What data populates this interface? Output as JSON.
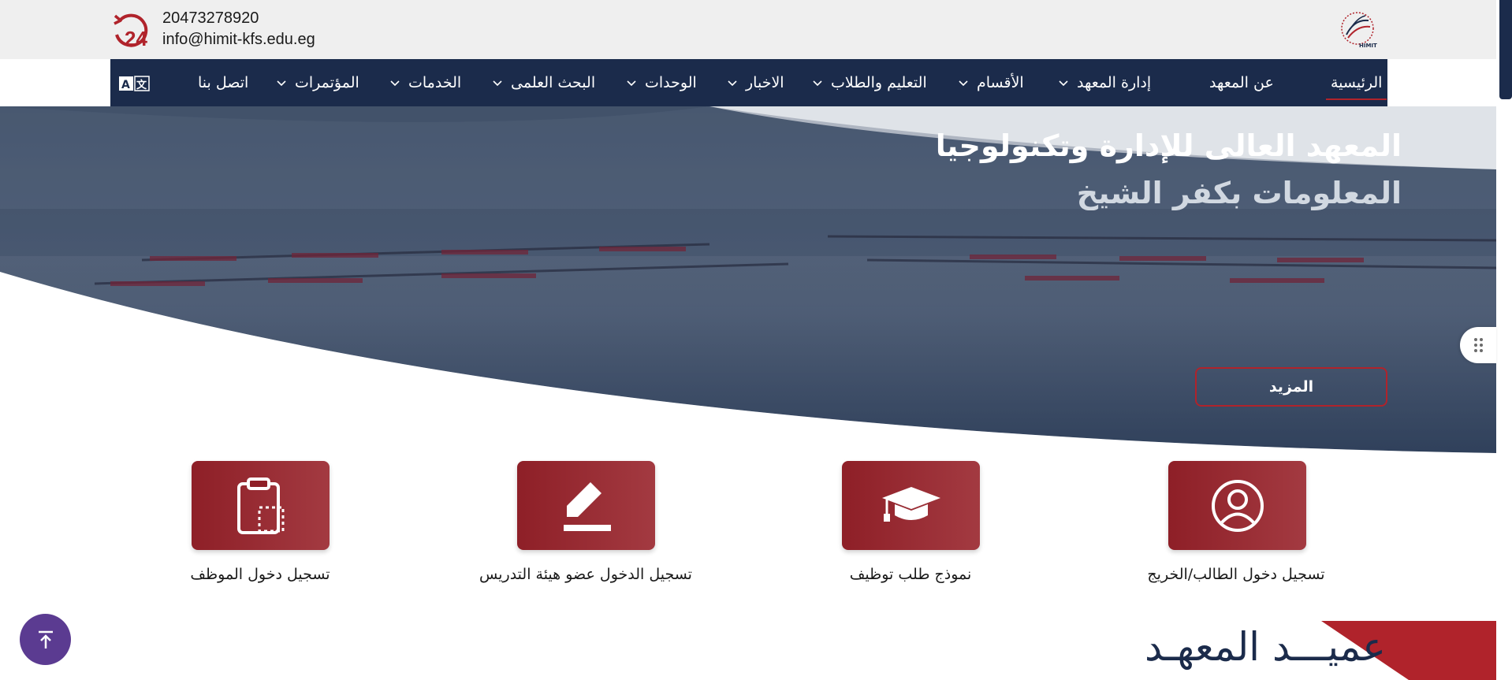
{
  "contact": {
    "phone": "20473278920",
    "email": "info@himit-kfs.edu.eg",
    "icon": "phone-24h-icon"
  },
  "logo": {
    "text": "HIMIT",
    "icon": "institute-logo"
  },
  "nav": {
    "items": [
      {
        "label": "الرئيسية",
        "active": true,
        "dropdown": false
      },
      {
        "label": "عن المعهد",
        "active": false,
        "dropdown": false
      },
      {
        "label": "إدارة المعهد",
        "active": false,
        "dropdown": true
      },
      {
        "label": "الأقسام",
        "active": false,
        "dropdown": true
      },
      {
        "label": "التعليم والطلاب",
        "active": false,
        "dropdown": true
      },
      {
        "label": "الاخبار",
        "active": false,
        "dropdown": true
      },
      {
        "label": "الوحدات",
        "active": false,
        "dropdown": true
      },
      {
        "label": "البحث العلمى",
        "active": false,
        "dropdown": true
      },
      {
        "label": "الخدمات",
        "active": false,
        "dropdown": true
      },
      {
        "label": "المؤتمرات",
        "active": false,
        "dropdown": true
      },
      {
        "label": "اتصل بنا",
        "active": false,
        "dropdown": false
      }
    ],
    "translate_icon": "translate-icon"
  },
  "hero": {
    "title_line1": "المعهد العالى للإدارة وتكنولوجيا",
    "title_line2": "المعلومات بكفر الشيخ",
    "more_label": "المزيد"
  },
  "quick_links": [
    {
      "label": "تسجيل دخول الطالب/الخريج",
      "icon": "user-circle-icon"
    },
    {
      "label": "نموذج طلب توظيف",
      "icon": "graduation-cap-icon"
    },
    {
      "label": "تسجيل الدخول عضو هيئة التدريس",
      "icon": "pencil-icon"
    },
    {
      "label": "تسجيل دخول الموظف",
      "icon": "clipboard-icon"
    }
  ],
  "dean": {
    "title": "عميـــد المعهـد"
  },
  "colors": {
    "navy": "#1b2b4b",
    "maroon": "#8e1f27",
    "red": "#b0232b",
    "purple": "#5b3b91"
  }
}
